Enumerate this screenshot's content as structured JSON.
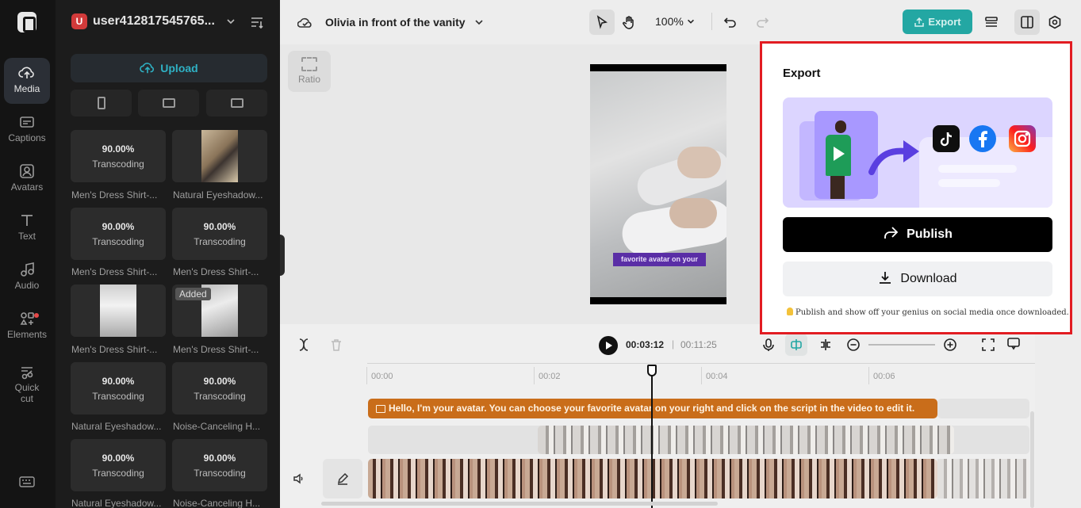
{
  "rail": {
    "items": [
      {
        "label": "Media",
        "icon": "cloud-upload-icon"
      },
      {
        "label": "Captions",
        "icon": "captions-icon"
      },
      {
        "label": "Avatars",
        "icon": "avatar-icon"
      },
      {
        "label": "Text",
        "icon": "text-icon"
      },
      {
        "label": "Audio",
        "icon": "music-note-icon"
      },
      {
        "label": "Elements",
        "icon": "elements-icon"
      },
      {
        "label": "Quick cut",
        "icon": "quick-cut-icon"
      }
    ],
    "active": "Media"
  },
  "panel": {
    "badge": "U",
    "username": "user412817545765...",
    "upload_label": "Upload",
    "tiles": [
      {
        "pct": "90.00%",
        "status": "Transcoding",
        "name": "Men's Dress Shirt-..."
      },
      {
        "pct": "",
        "status": "",
        "name": "Natural Eyeshadow..."
      },
      {
        "pct": "90.00%",
        "status": "Transcoding",
        "name": "Men's Dress Shirt-..."
      },
      {
        "pct": "90.00%",
        "status": "Transcoding",
        "name": "Men's Dress Shirt-..."
      },
      {
        "pct": "",
        "status": "",
        "name": "Men's Dress Shirt-..."
      },
      {
        "pct": "",
        "status": "",
        "added": "Added",
        "name": "Men's Dress Shirt-..."
      },
      {
        "pct": "90.00%",
        "status": "Transcoding",
        "name": "Natural Eyeshadow..."
      },
      {
        "pct": "90.00%",
        "status": "Transcoding",
        "name": "Noise-Canceling H..."
      },
      {
        "pct": "90.00%",
        "status": "Transcoding",
        "name": "Natural Eyeshadow..."
      },
      {
        "pct": "90.00%",
        "status": "Transcoding",
        "name": "Noise-Canceling H..."
      }
    ]
  },
  "topbar": {
    "project_title": "Olivia in front of the vanity",
    "zoom": "100%",
    "export_label": "Export"
  },
  "canvas": {
    "ratio_label": "Ratio",
    "subtitle": "favorite avatar on your"
  },
  "timeline": {
    "current_time": "00:03:12",
    "separator": "|",
    "total_time": "00:11:25",
    "ticks": [
      "00:00",
      "00:02",
      "00:04",
      "00:06"
    ],
    "script_text": "Hello, I'm your avatar. You can choose your favorite avatar on your right and click on the script in the video to edit it."
  },
  "export_panel": {
    "title": "Export",
    "publish_label": "Publish",
    "download_label": "Download",
    "tip": "Publish and show off your genius on social media once downloaded.",
    "social": [
      "tiktok-icon",
      "facebook-icon",
      "instagram-icon"
    ]
  },
  "colors": {
    "accent_teal": "#23a7a3",
    "script_track": "#c96d1a",
    "highlight_border": "#e21c22"
  }
}
